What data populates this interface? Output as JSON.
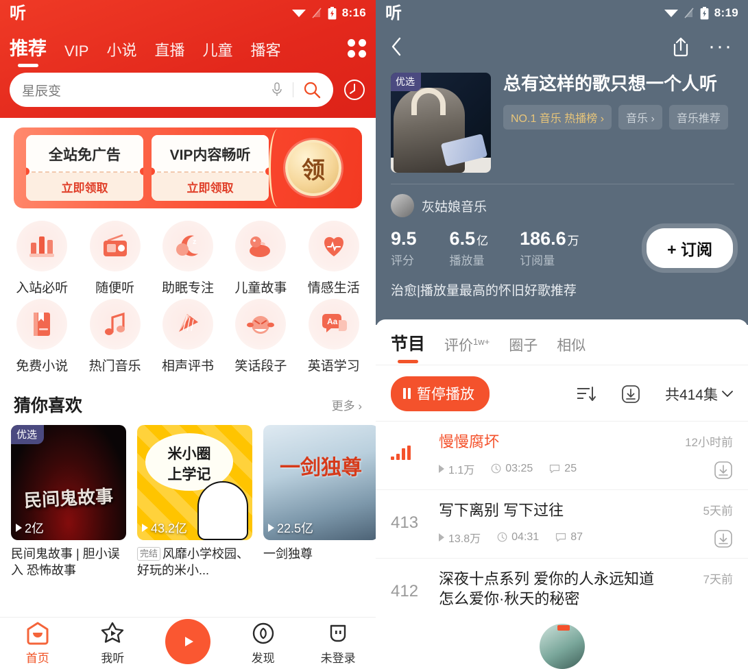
{
  "left": {
    "status": {
      "app_logo": "听",
      "time": "8:16",
      "wifi_icon": "wifi-icon",
      "signal_icon": "signal-off-icon",
      "battery_icon": "battery-charging-icon"
    },
    "tabs": [
      {
        "label": "推荐",
        "active": true
      },
      {
        "label": "VIP",
        "active": false
      },
      {
        "label": "小说",
        "active": false
      },
      {
        "label": "直播",
        "active": false
      },
      {
        "label": "儿童",
        "active": false
      },
      {
        "label": "播客",
        "active": false
      }
    ],
    "grid_icon": "grid-menu-icon",
    "search": {
      "value": "星辰变",
      "mic_icon": "microphone-icon",
      "search_icon": "search-icon",
      "history_icon": "history-clock-icon"
    },
    "banner": {
      "coupons": [
        {
          "title": "全站免广告",
          "action": "立即领取"
        },
        {
          "title": "VIP内容畅听",
          "action": "立即领取"
        }
      ],
      "claim_label": "领"
    },
    "categories": [
      {
        "label": "入站必听",
        "icon": "bar-chart-icon"
      },
      {
        "label": "随便听",
        "icon": "radio-icon"
      },
      {
        "label": "助眠专注",
        "icon": "moon-sleep-icon"
      },
      {
        "label": "儿童故事",
        "icon": "duck-icon"
      },
      {
        "label": "情感生活",
        "icon": "heart-pulse-icon"
      },
      {
        "label": "免费小说",
        "icon": "book-icon"
      },
      {
        "label": "热门音乐",
        "icon": "music-note-icon"
      },
      {
        "label": "相声评书",
        "icon": "folding-fan-icon"
      },
      {
        "label": "笑话段子",
        "icon": "laughing-face-icon"
      },
      {
        "label": "英语学习",
        "icon": "aa-bubble-icon"
      }
    ],
    "guess": {
      "title": "猜你喜欢",
      "more": "更多",
      "cards": [
        {
          "badge": "优选",
          "plays": "2亿",
          "title": "民间鬼故事 | 胆小误入 恐怖故事",
          "art": "art1",
          "tag": ""
        },
        {
          "badge": "",
          "plays": "43.2亿",
          "title": "风靡小学校园、好玩的米小...",
          "art": "art2",
          "tag": "完结"
        },
        {
          "badge": "",
          "plays": "22.5亿",
          "title": "一剑独尊",
          "art": "art3",
          "tag": ""
        }
      ]
    },
    "nav": [
      {
        "label": "首页",
        "icon": "home-icon",
        "active": true
      },
      {
        "label": "我听",
        "icon": "star-play-icon",
        "active": false
      },
      {
        "label": "",
        "icon": "play-button-icon",
        "active": false
      },
      {
        "label": "发现",
        "icon": "discover-icon",
        "active": false
      },
      {
        "label": "未登录",
        "icon": "account-icon",
        "active": false
      }
    ]
  },
  "right": {
    "status": {
      "app_logo": "听",
      "time": "8:19",
      "wifi_icon": "wifi-icon",
      "signal_icon": "signal-off-icon",
      "battery_icon": "battery-charging-icon"
    },
    "nav": {
      "back_icon": "back-chevron-icon",
      "share_icon": "share-icon",
      "more_icon": "more-dots-icon"
    },
    "album": {
      "cover_badge": "优选",
      "title": "总有这样的歌只想一个人听",
      "tags": [
        {
          "text": "NO.1 音乐 热播榜",
          "chevron": "›",
          "gold": true
        },
        {
          "text": "音乐",
          "chevron": "›",
          "gold": false
        },
        {
          "text": "音乐推荐",
          "chevron": "",
          "gold": false
        }
      ],
      "author": "灰姑娘音乐",
      "stats": [
        {
          "value": "9.5",
          "unit": "",
          "label": "评分"
        },
        {
          "value": "6.5",
          "unit": "亿",
          "label": "播放量"
        },
        {
          "value": "186.6",
          "unit": "万",
          "label": "订阅量"
        }
      ],
      "subscribe": "+ 订阅",
      "description": "治愈|播放量最高的怀旧好歌推荐"
    },
    "tabs": [
      {
        "label": "节目",
        "sup": "",
        "active": true
      },
      {
        "label": "评价",
        "sup": "1w+",
        "active": false
      },
      {
        "label": "圈子",
        "sup": "",
        "active": false
      },
      {
        "label": "相似",
        "sup": "",
        "active": false
      }
    ],
    "controls": {
      "play_label": "暂停播放",
      "pause_icon": "pause-icon",
      "sort_icon": "sort-descending-icon",
      "download_icon": "download-icon",
      "count_label": "共414集",
      "chevron_icon": "chevron-down-icon"
    },
    "episodes": [
      {
        "index": "",
        "equalizer": true,
        "title": "慢慢腐坏",
        "playing": true,
        "plays": "1.1万",
        "duration": "03:25",
        "comments": "25",
        "time": "12小时前",
        "download_icon": "download-icon"
      },
      {
        "index": "413",
        "equalizer": false,
        "title": "写下离别 写下过往",
        "playing": false,
        "plays": "13.8万",
        "duration": "04:31",
        "comments": "87",
        "time": "5天前",
        "download_icon": "download-icon"
      },
      {
        "index": "412",
        "equalizer": false,
        "title": "深夜十点系列 爱你的人永远知道怎么爱你·秋天的秘密",
        "playing": false,
        "plays": "",
        "duration": "",
        "comments": "",
        "time": "7天前",
        "download_icon": "download-icon"
      }
    ],
    "mini_player": "mini-player-icon"
  },
  "colors": {
    "brand_red": "#e62e20",
    "accent_orange": "#f4522c",
    "hero_slate": "#5b6b7b",
    "gold": "#e8c579",
    "badge_purple": "#4b4a80"
  }
}
